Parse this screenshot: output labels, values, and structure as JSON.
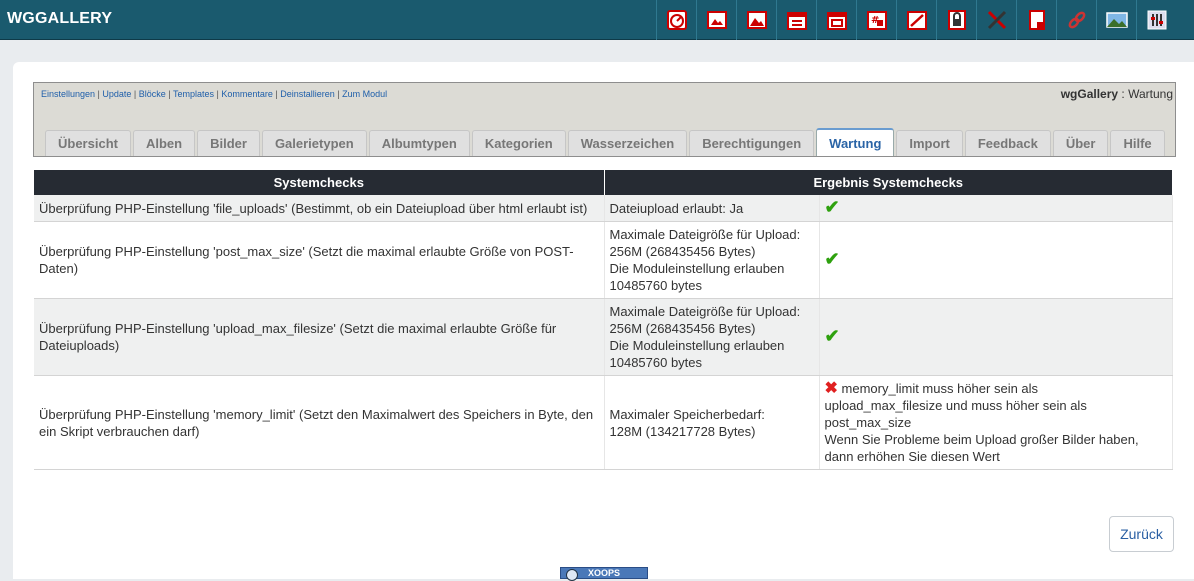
{
  "app": {
    "brand": "WGGALLERY"
  },
  "toolbar_icons": [
    "dashboard-icon",
    "image-gallery-icon",
    "images-icon",
    "calendar-icon",
    "calendar-list-icon",
    "number-calendar-icon",
    "edit-chart-icon",
    "lock-icon",
    "tools-icon",
    "document-delete-icon",
    "link-icon",
    "landscape-icon",
    "settings-sliders-icon"
  ],
  "module": {
    "links": [
      "Einstellungen",
      "Update",
      "Blöcke",
      "Templates",
      "Kommentare",
      "Deinstallieren",
      "Zum Modul"
    ],
    "separator": " | ",
    "title_bold": "wgGallery",
    "title_rest": " : Wartung"
  },
  "tabs": [
    {
      "label": "Übersicht",
      "active": false
    },
    {
      "label": "Alben",
      "active": false
    },
    {
      "label": "Bilder",
      "active": false
    },
    {
      "label": "Galerietypen",
      "active": false
    },
    {
      "label": "Albumtypen",
      "active": false
    },
    {
      "label": "Kategorien",
      "active": false
    },
    {
      "label": "Wasserzeichen",
      "active": false
    },
    {
      "label": "Berechtigungen",
      "active": false
    },
    {
      "label": "Wartung",
      "active": true
    },
    {
      "label": "Import",
      "active": false
    },
    {
      "label": "Feedback",
      "active": false
    },
    {
      "label": "Über",
      "active": false
    },
    {
      "label": "Hilfe",
      "active": false
    }
  ],
  "table": {
    "headers": [
      "Systemchecks",
      "Ergebnis Systemchecks"
    ],
    "rows": [
      {
        "check": "Überprüfung PHP-Einstellung 'file_uploads' (Bestimmt, ob ein Dateiupload über html erlaubt ist)",
        "value_lines": [
          "Dateiupload erlaubt: Ja"
        ],
        "status": "ok",
        "message_lines": []
      },
      {
        "check": "Überprüfung PHP-Einstellung 'post_max_size' (Setzt die maximal erlaubte Größe von POST-Daten)",
        "value_lines": [
          "Maximale Dateigröße für Upload:",
          "256M (268435456 Bytes)",
          "Die Moduleinstellung erlauben",
          "10485760 bytes"
        ],
        "status": "ok",
        "message_lines": []
      },
      {
        "check": "Überprüfung PHP-Einstellung 'upload_max_filesize' (Setzt die maximal erlaubte Größe für Dateiuploads)",
        "value_lines": [
          "Maximale Dateigröße für Upload:",
          "256M (268435456 Bytes)",
          "Die Moduleinstellung erlauben",
          "10485760 bytes"
        ],
        "status": "ok",
        "message_lines": []
      },
      {
        "check": "Überprüfung PHP-Einstellung 'memory_limit' (Setzt den Maximalwert des Speichers in Byte, den ein Skript verbrauchen darf)",
        "value_lines": [
          "Maximaler Speicherbedarf:",
          "128M (134217728 Bytes)"
        ],
        "status": "error",
        "message_lines": [
          "memory_limit muss höher sein als",
          "upload_max_filesize und muss höher sein als",
          "post_max_size",
          "Wenn Sie Probleme beim Upload großer Bilder haben,",
          "dann erhöhen Sie diesen Wert"
        ]
      }
    ]
  },
  "back_button": "Zurück",
  "footer_badge": "XOOPS",
  "colors": {
    "topbar": "#1a5a6e",
    "tableHeader": "#262b33",
    "ok": "#2ea10e",
    "error": "#e02020"
  }
}
